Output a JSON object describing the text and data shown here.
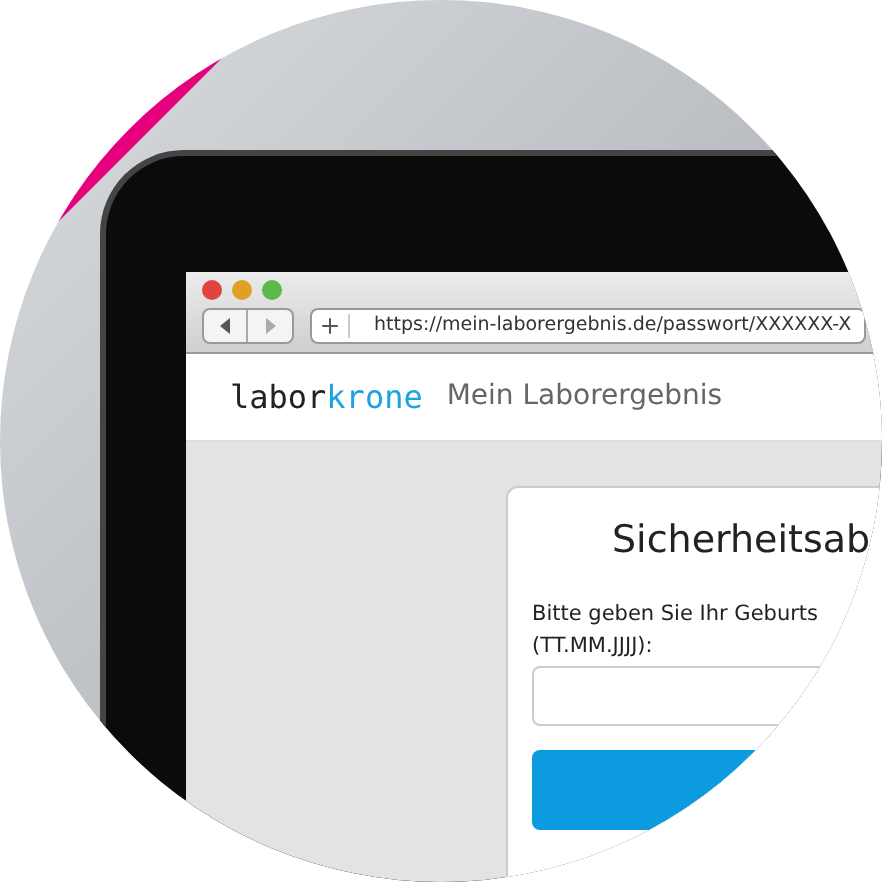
{
  "browser": {
    "url": "https://mein-laborergebnis.de/passwort/XXXXXX-X"
  },
  "site_header": {
    "logo": {
      "part_1": "labor",
      "part_2": "krone"
    },
    "title": "Mein Laborergebnis"
  },
  "card": {
    "title": "Sicherheitsab",
    "prompt_lines": [
      "Bitte geben Sie Ihr Geburts",
      "(TT.MM.JJJJ):"
    ]
  }
}
